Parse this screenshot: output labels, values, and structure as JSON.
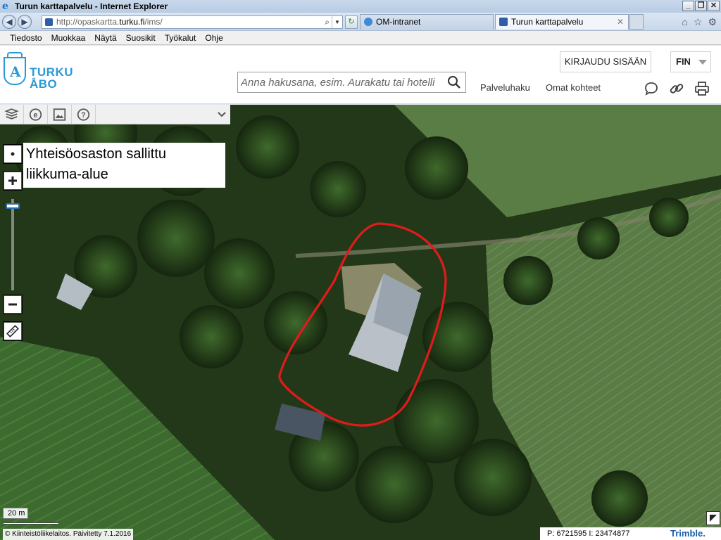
{
  "browser": {
    "window_title": "Turun karttapalvelu - Internet Explorer",
    "address": {
      "prefix": "http://opaskartta.",
      "domain": "turku.fi",
      "path": "/ims/"
    },
    "tabs": [
      {
        "label": "OM-intranet"
      },
      {
        "label": "Turun karttapalvelu"
      }
    ],
    "menu": [
      "Tiedosto",
      "Muokkaa",
      "Näytä",
      "Suosikit",
      "Työkalut",
      "Ohje"
    ]
  },
  "header": {
    "logo_lines": [
      "TURKU",
      "ÅBO"
    ],
    "login_label": "KIRJAUDU SISÄÄN",
    "language": "FIN",
    "search_placeholder": "Anna hakusana, esim. Aurakatu tai hotelli",
    "links": {
      "services": "Palveluhaku",
      "my_items": "Omat kohteet"
    }
  },
  "map": {
    "annotation_label": "Yhteisöosaston sallittu liikkuma-alue",
    "scale_label": "20 m",
    "copyright": "© Kiinteistöliikelaitos. Päivitetty 7.1.2016",
    "coordinates": "P: 6721595 I: 23474877",
    "provider": "Trimble.",
    "zoom_level_fraction": 0.05,
    "area_outline_color": "#e01b1b"
  },
  "icons": {
    "map_tools": [
      "layers-icon",
      "e-services-icon",
      "image-icon",
      "help-icon"
    ],
    "header": [
      "feedback-icon",
      "link-icon",
      "print-icon"
    ]
  }
}
